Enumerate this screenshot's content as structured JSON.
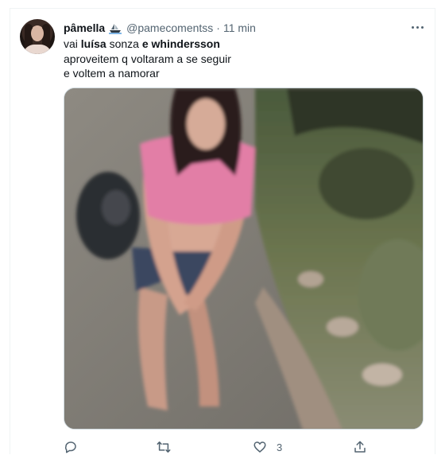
{
  "tweet": {
    "display_name": "pâmella",
    "handle": "@pamecomentss",
    "separator": "·",
    "time": "11 min",
    "text": {
      "line1_a": "vai ",
      "line1_b": "luísa",
      "line1_c": " sonza ",
      "line1_d": "e whindersson",
      "line2": "aproveitem q voltaram a se seguir",
      "line3": "e voltem a namorar"
    },
    "media_icon": "photo-meme-woman-on-road",
    "likes": "3"
  },
  "icons": {
    "badge": "ship-icon",
    "more": "more-dots-icon",
    "reply": "reply-icon",
    "retweet": "retweet-icon",
    "like": "heart-icon",
    "share": "share-icon"
  },
  "colors": {
    "text": "#0f1419",
    "secondary": "#536471",
    "border": "#eff3f4"
  }
}
